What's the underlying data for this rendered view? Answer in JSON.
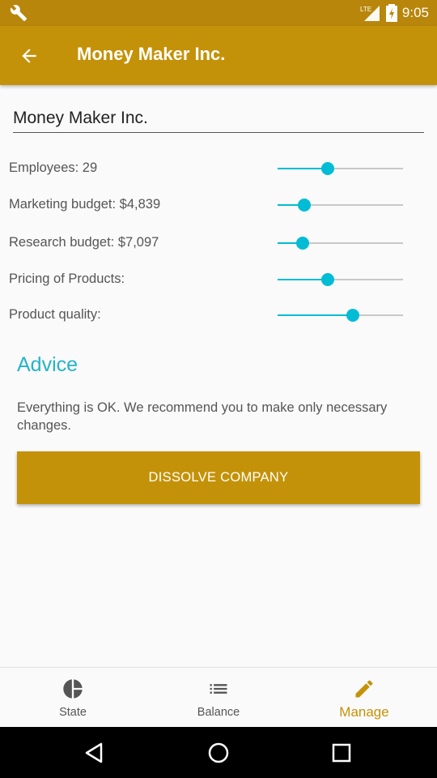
{
  "status_bar": {
    "time": "9:05",
    "network_label": "LTE",
    "icons": [
      "wrench-icon",
      "signal-icon",
      "battery-icon"
    ]
  },
  "app_bar": {
    "title": "Money Maker Inc.",
    "back_icon": "arrow-back-icon"
  },
  "company_name_field": {
    "value": "Money Maker Inc."
  },
  "settings": [
    {
      "id": "employees",
      "label": "Employees: 29",
      "value": 0.4
    },
    {
      "id": "marketing",
      "label": "Marketing budget: $4,839",
      "value": 0.21
    },
    {
      "id": "research",
      "label": "Research budget: $7,097",
      "value": 0.2
    },
    {
      "id": "pricing",
      "label": "Pricing of Products:",
      "value": 0.4
    },
    {
      "id": "quality",
      "label": "Product quality:",
      "value": 0.6
    }
  ],
  "advice": {
    "title": "Advice",
    "text": "Everything is OK. We recommend you to make only necessary changes."
  },
  "dissolve_button": {
    "label": "DISSOLVE COMPANY"
  },
  "bottom_nav": {
    "items": [
      {
        "label": "State",
        "icon": "pie-chart-icon",
        "active": false
      },
      {
        "label": "Balance",
        "icon": "list-icon",
        "active": false
      },
      {
        "label": "Manage",
        "icon": "pencil-icon",
        "active": true
      }
    ]
  },
  "colors": {
    "primary": "#c49209",
    "primary_dark": "#b8860b",
    "accent": "#00bcd4",
    "advice_title": "#26b3c9"
  }
}
